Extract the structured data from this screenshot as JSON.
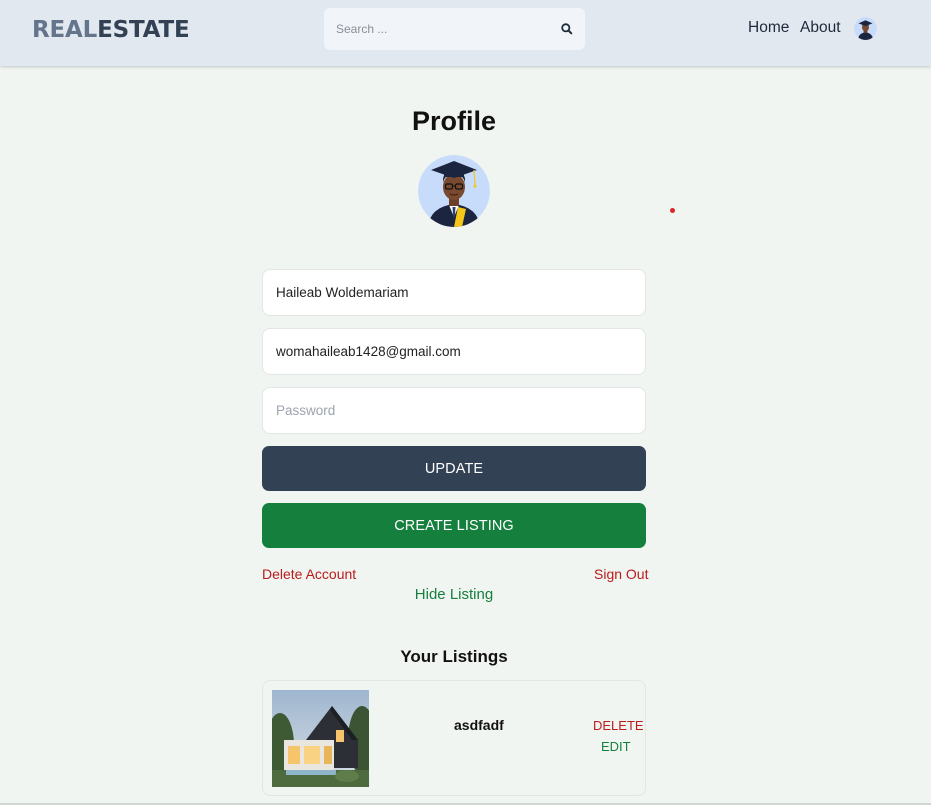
{
  "header": {
    "logo_part1": "REAL",
    "logo_part2": "ESTATE",
    "search_placeholder": "Search ...",
    "search_icon": "search-icon",
    "nav": {
      "home": "Home",
      "about": "About"
    }
  },
  "profile": {
    "title": "Profile",
    "avatar_icon": "graduate-avatar",
    "username": "Haileab Woldemariam",
    "email": "womahaileab1428@gmail.com",
    "password_placeholder": "Password",
    "update_label": "UPDATE",
    "create_listing_label": "CREATE LISTING",
    "delete_account_label": "Delete Account",
    "sign_out_label": "Sign Out",
    "hide_listing_label": "Hide Listing"
  },
  "listings": {
    "title": "Your Listings",
    "items": [
      {
        "name": "asdfadf",
        "delete_label": "DELETE",
        "edit_label": "EDIT"
      }
    ]
  },
  "colors": {
    "header_bg": "#e2e8f0",
    "update_button": "#334155",
    "create_button": "#15803d",
    "danger": "#b91c1c",
    "success": "#15803d"
  }
}
